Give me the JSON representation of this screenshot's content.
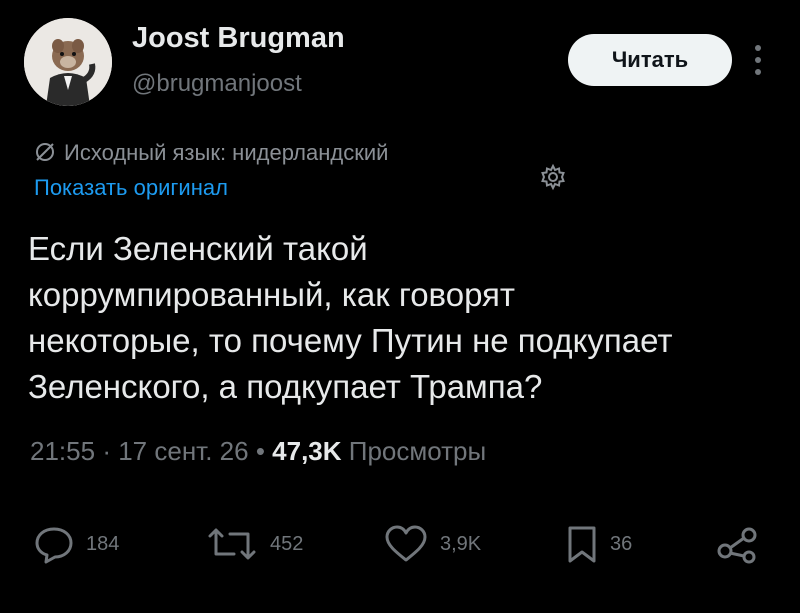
{
  "user": {
    "display_name": "Joost Brugman",
    "handle": "@brugmanjoost",
    "avatar_icon": "avatar-photo"
  },
  "follow_button": {
    "label": "Читать"
  },
  "translation": {
    "source_language": "Исходный язык: нидерландский",
    "show_original": "Показать оригинал"
  },
  "tweet": {
    "lines": [
      "Если Зеленский такой",
      "коррумпированный, как говорят",
      "некоторые, то почему Путин не подкупает",
      "Зеленского, а подкупает Трампа?"
    ],
    "time": "21:55",
    "separator": "·",
    "date": "17 сент. 26",
    "dot": "•",
    "views_count": "47,3K",
    "views_label": "Просмотры"
  },
  "actions": {
    "replies": "184",
    "reposts": "452",
    "likes": "3,9K",
    "bookmarks": "36"
  },
  "colors": {
    "background": "#000000",
    "text": "#e7e9ea",
    "secondary": "#71767b",
    "link": "#1d9bf0",
    "button_bg": "#eff3f4"
  },
  "icons": [
    "more-icon",
    "globe-icon",
    "settings-icon",
    "reply-icon",
    "repost-icon",
    "like-icon",
    "bookmark-icon",
    "share-icon"
  ]
}
